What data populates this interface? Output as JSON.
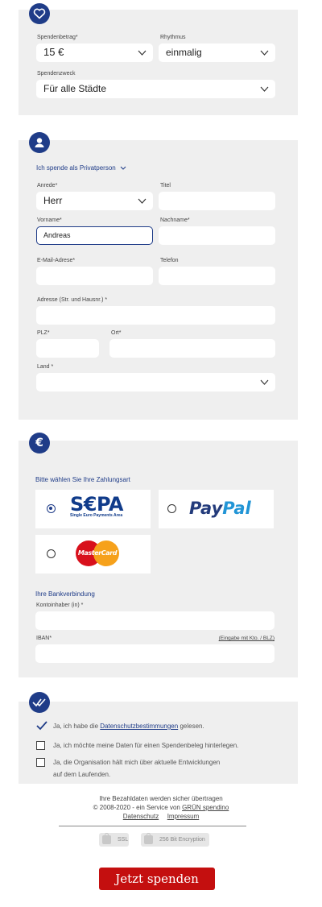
{
  "donation": {
    "amount_label": "Spendenbetrag*",
    "amount_value": "15 €",
    "rhythm_label": "Rhythmus",
    "rhythm_value": "einmalig",
    "purpose_label": "Spendenzweck",
    "purpose_value": "Für alle Städte"
  },
  "person": {
    "donor_type": "Ich spende als Privatperson",
    "salutation_label": "Anrede*",
    "salutation_value": "Herr",
    "title_label": "Titel",
    "firstname_label": "Vorname*",
    "firstname_value": "Andreas",
    "lastname_label": "Nachname*",
    "email_label": "E-Mail-Adrese*",
    "phone_label": "Telefon",
    "address_label": "Adresse (Str. und Hausnr.) *",
    "zip_label": "PLZ*",
    "city_label": "Ort*",
    "country_label": "Land *"
  },
  "payment": {
    "heading": "Bitte wählen Sie Ihre Zahlungsart",
    "sepa_logo": "S€PA",
    "sepa_sub": "Single Euro Payments Area",
    "paypal_logo_a": "Pay",
    "paypal_logo_b": "Pal",
    "mastercard_logo": "MasterCard",
    "bank_heading": "Ihre Bankverbindung",
    "holder_label": "Kontoinhaber (in) *",
    "iban_label": "IBAN*",
    "iban_link": "(Eingabe mit Kto. / BLZ)"
  },
  "consent": {
    "privacy_prefix": "Ja, ich habe die ",
    "privacy_link": "Datenschutzbestimmungen",
    "privacy_suffix": " gelesen.",
    "receipt": "Ja, ich möchte meine Daten für einen Spendenbeleg hinterlegen.",
    "updates_line1": "Ja, die Organisation hält mich über aktuelle Entwicklungen",
    "updates_line2": "auf dem Laufenden."
  },
  "footer": {
    "secure": "Ihre Bezahldaten werden sicher übertragen",
    "copyright_prefix": "© 2008-2020 - ein Service von ",
    "copyright_link": "GRÜN spendino",
    "privacy": "Datenschutz",
    "imprint": "Impressum",
    "ssl": "SSL",
    "encryption": "256 Bit Encryption"
  },
  "submit_label": "Jetzt spenden",
  "colors": {
    "accent": "#1f3c88",
    "submit": "#c40f0f",
    "panel": "#efefef"
  },
  "icons": [
    "heart-icon",
    "user-icon",
    "euro-icon",
    "double-check-icon",
    "chevron-down-icon",
    "lock-icon",
    "check-icon"
  ]
}
